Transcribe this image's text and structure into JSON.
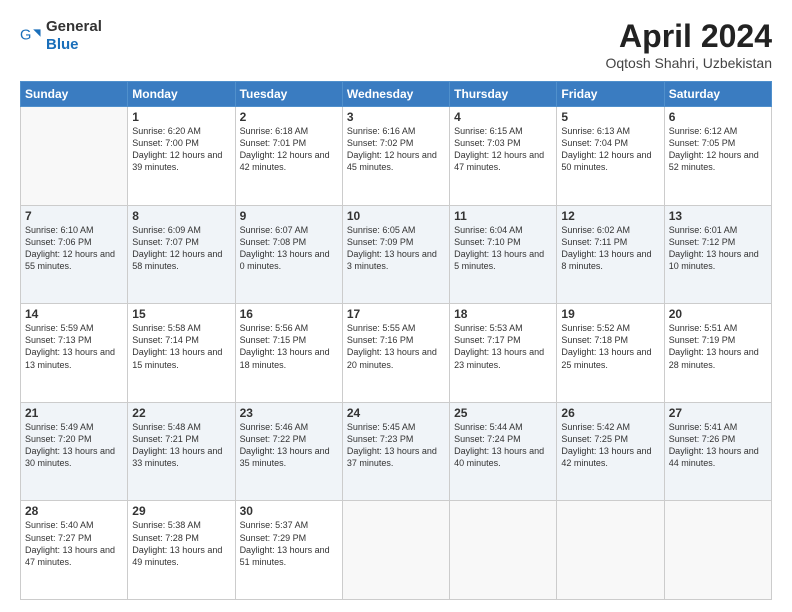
{
  "header": {
    "logo": {
      "general": "General",
      "blue": "Blue"
    },
    "title": "April 2024",
    "subtitle": "Oqtosh Shahri, Uzbekistan"
  },
  "weekdays": [
    "Sunday",
    "Monday",
    "Tuesday",
    "Wednesday",
    "Thursday",
    "Friday",
    "Saturday"
  ],
  "weeks": [
    [
      {
        "day": null
      },
      {
        "day": 1,
        "sunrise": "6:20 AM",
        "sunset": "7:00 PM",
        "daylight": "12 hours and 39 minutes."
      },
      {
        "day": 2,
        "sunrise": "6:18 AM",
        "sunset": "7:01 PM",
        "daylight": "12 hours and 42 minutes."
      },
      {
        "day": 3,
        "sunrise": "6:16 AM",
        "sunset": "7:02 PM",
        "daylight": "12 hours and 45 minutes."
      },
      {
        "day": 4,
        "sunrise": "6:15 AM",
        "sunset": "7:03 PM",
        "daylight": "12 hours and 47 minutes."
      },
      {
        "day": 5,
        "sunrise": "6:13 AM",
        "sunset": "7:04 PM",
        "daylight": "12 hours and 50 minutes."
      },
      {
        "day": 6,
        "sunrise": "6:12 AM",
        "sunset": "7:05 PM",
        "daylight": "12 hours and 52 minutes."
      }
    ],
    [
      {
        "day": 7,
        "sunrise": "6:10 AM",
        "sunset": "7:06 PM",
        "daylight": "12 hours and 55 minutes."
      },
      {
        "day": 8,
        "sunrise": "6:09 AM",
        "sunset": "7:07 PM",
        "daylight": "12 hours and 58 minutes."
      },
      {
        "day": 9,
        "sunrise": "6:07 AM",
        "sunset": "7:08 PM",
        "daylight": "13 hours and 0 minutes."
      },
      {
        "day": 10,
        "sunrise": "6:05 AM",
        "sunset": "7:09 PM",
        "daylight": "13 hours and 3 minutes."
      },
      {
        "day": 11,
        "sunrise": "6:04 AM",
        "sunset": "7:10 PM",
        "daylight": "13 hours and 5 minutes."
      },
      {
        "day": 12,
        "sunrise": "6:02 AM",
        "sunset": "7:11 PM",
        "daylight": "13 hours and 8 minutes."
      },
      {
        "day": 13,
        "sunrise": "6:01 AM",
        "sunset": "7:12 PM",
        "daylight": "13 hours and 10 minutes."
      }
    ],
    [
      {
        "day": 14,
        "sunrise": "5:59 AM",
        "sunset": "7:13 PM",
        "daylight": "13 hours and 13 minutes."
      },
      {
        "day": 15,
        "sunrise": "5:58 AM",
        "sunset": "7:14 PM",
        "daylight": "13 hours and 15 minutes."
      },
      {
        "day": 16,
        "sunrise": "5:56 AM",
        "sunset": "7:15 PM",
        "daylight": "13 hours and 18 minutes."
      },
      {
        "day": 17,
        "sunrise": "5:55 AM",
        "sunset": "7:16 PM",
        "daylight": "13 hours and 20 minutes."
      },
      {
        "day": 18,
        "sunrise": "5:53 AM",
        "sunset": "7:17 PM",
        "daylight": "13 hours and 23 minutes."
      },
      {
        "day": 19,
        "sunrise": "5:52 AM",
        "sunset": "7:18 PM",
        "daylight": "13 hours and 25 minutes."
      },
      {
        "day": 20,
        "sunrise": "5:51 AM",
        "sunset": "7:19 PM",
        "daylight": "13 hours and 28 minutes."
      }
    ],
    [
      {
        "day": 21,
        "sunrise": "5:49 AM",
        "sunset": "7:20 PM",
        "daylight": "13 hours and 30 minutes."
      },
      {
        "day": 22,
        "sunrise": "5:48 AM",
        "sunset": "7:21 PM",
        "daylight": "13 hours and 33 minutes."
      },
      {
        "day": 23,
        "sunrise": "5:46 AM",
        "sunset": "7:22 PM",
        "daylight": "13 hours and 35 minutes."
      },
      {
        "day": 24,
        "sunrise": "5:45 AM",
        "sunset": "7:23 PM",
        "daylight": "13 hours and 37 minutes."
      },
      {
        "day": 25,
        "sunrise": "5:44 AM",
        "sunset": "7:24 PM",
        "daylight": "13 hours and 40 minutes."
      },
      {
        "day": 26,
        "sunrise": "5:42 AM",
        "sunset": "7:25 PM",
        "daylight": "13 hours and 42 minutes."
      },
      {
        "day": 27,
        "sunrise": "5:41 AM",
        "sunset": "7:26 PM",
        "daylight": "13 hours and 44 minutes."
      }
    ],
    [
      {
        "day": 28,
        "sunrise": "5:40 AM",
        "sunset": "7:27 PM",
        "daylight": "13 hours and 47 minutes."
      },
      {
        "day": 29,
        "sunrise": "5:38 AM",
        "sunset": "7:28 PM",
        "daylight": "13 hours and 49 minutes."
      },
      {
        "day": 30,
        "sunrise": "5:37 AM",
        "sunset": "7:29 PM",
        "daylight": "13 hours and 51 minutes."
      },
      {
        "day": null
      },
      {
        "day": null
      },
      {
        "day": null
      },
      {
        "day": null
      }
    ]
  ]
}
